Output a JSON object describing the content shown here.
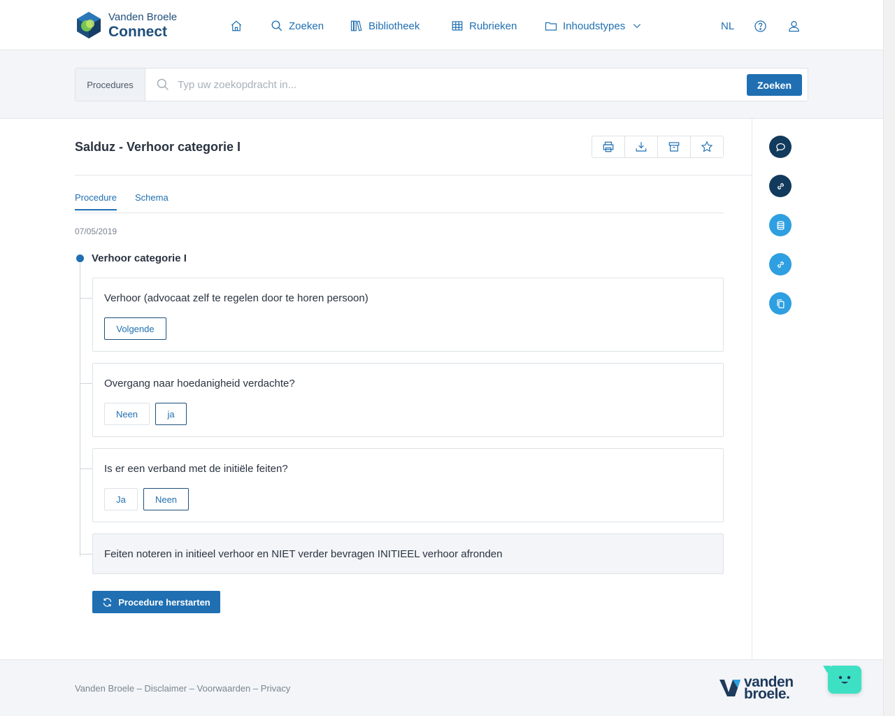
{
  "brand": {
    "name_top": "Vanden Broele",
    "name_bottom": "Connect"
  },
  "nav": {
    "home_icon": "home-icon",
    "search": "Zoeken",
    "library": "Bibliotheek",
    "rubrics": "Rubrieken",
    "content_types": "Inhoudstypes",
    "language": "NL"
  },
  "search": {
    "scope": "Procedures",
    "placeholder": "Typ uw zoekopdracht in...",
    "button": "Zoeken"
  },
  "page": {
    "title": "Salduz - Verhoor categorie I",
    "tabs": [
      "Procedure",
      "Schema"
    ],
    "date": "07/05/2019",
    "root_label": "Verhoor categorie I"
  },
  "steps": [
    {
      "question": "Verhoor (advocaat zelf te regelen door te horen persoon)",
      "options": [
        "Volgende"
      ],
      "selected": "Volgende"
    },
    {
      "question": "Overgang naar hoedanigheid verdachte?",
      "options": [
        "Neen",
        "ja"
      ],
      "selected": "ja"
    },
    {
      "question": "Is er een verband met de initiële feiten?",
      "options": [
        "Ja",
        "Neen"
      ],
      "selected": "Neen"
    },
    {
      "question": "Feiten noteren in initieel verhoor en NIET verder bevragen INITIEEL verhoor afronden"
    }
  ],
  "restart_button": "Procedure herstarten",
  "footer": {
    "links": [
      "Vanden Broele",
      "Disclaimer",
      "Voorwaarden",
      "Privacy"
    ],
    "separator": " – ",
    "logo_text_1": "vanden",
    "logo_text_2": "broele."
  },
  "colors": {
    "accent": "#1f6fb2",
    "navy": "#123a5c",
    "light_blue": "#2e9fe0",
    "chat": "#3ee0c4"
  }
}
